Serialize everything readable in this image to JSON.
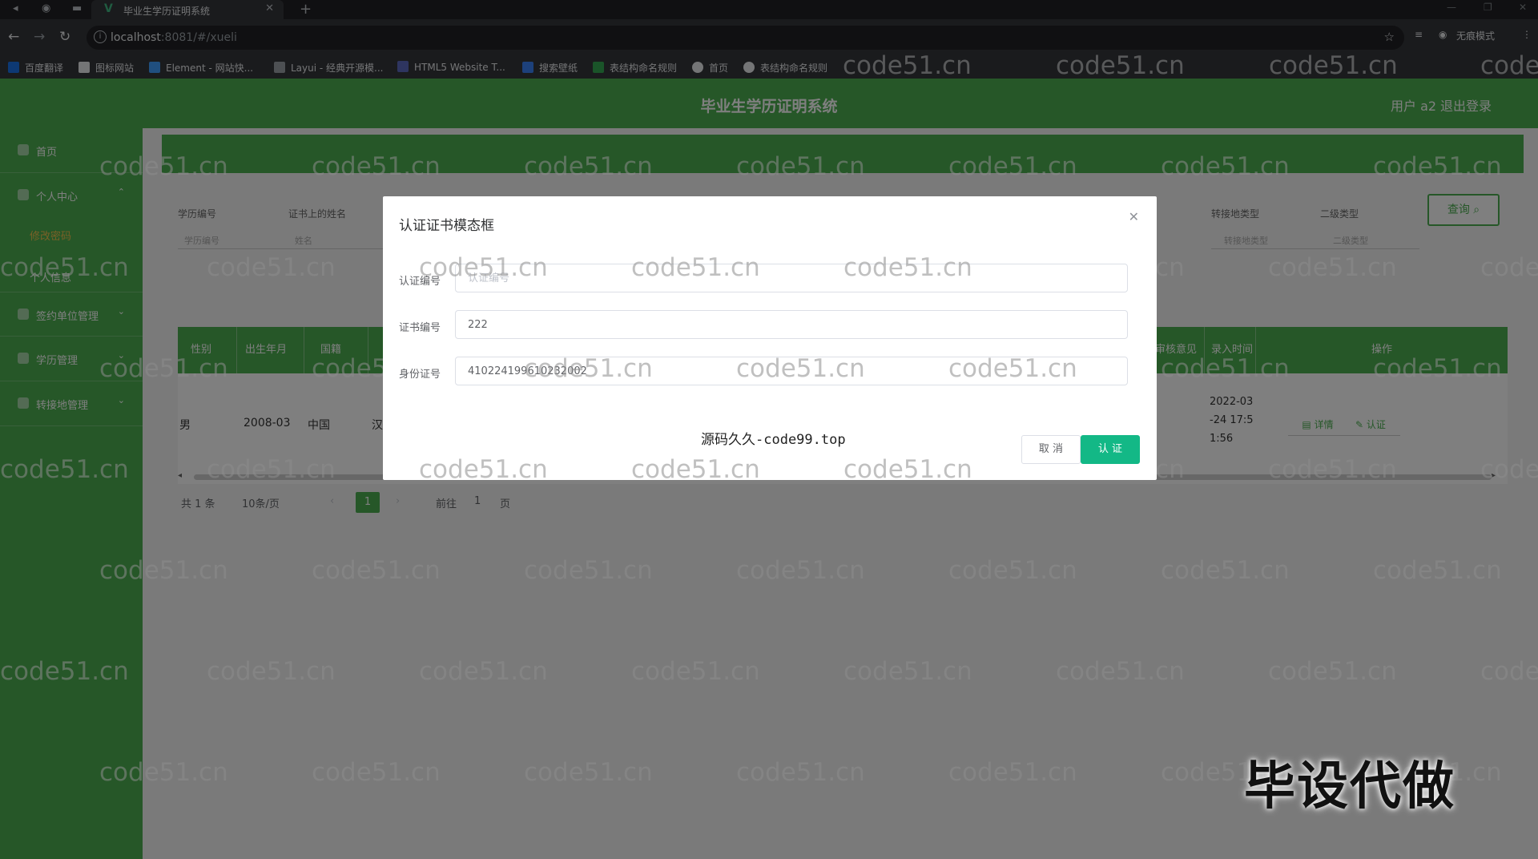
{
  "browser": {
    "tab_title": "毕业生学历证明系统",
    "url_host": "localhost",
    "url_rest": ":8081/#/xueli",
    "profile_label": "无痕模式",
    "bookmarks": [
      "百度翻译",
      "图标网站",
      "Element - 网站快...",
      "Layui - 经典开源模...",
      "HTML5 Website T...",
      "搜索壁纸",
      "表结构命名规则",
      "首页",
      "表结构命名规则"
    ]
  },
  "app": {
    "title": "毕业生学历证明系统",
    "user_label": "用户 a2",
    "logout_label": "退出登录"
  },
  "sidebar": {
    "items": [
      {
        "label": "首页"
      },
      {
        "label": "个人中心"
      },
      {
        "label": "签约单位管理"
      },
      {
        "label": "学历管理"
      },
      {
        "label": "转接地管理"
      }
    ],
    "sub_items": [
      {
        "label": "修改密码"
      },
      {
        "label": "个人信息"
      }
    ]
  },
  "search": {
    "fields": [
      "学历编号",
      "证书上的姓名",
      "转接地类型",
      "二级类型"
    ],
    "hints": [
      "学历编号",
      "姓名",
      "转接地类型",
      "二级类型"
    ],
    "query_label": "查询"
  },
  "table": {
    "columns": [
      "性别",
      "出生年月",
      "国籍",
      "审核意见",
      "录入时间",
      "操作"
    ],
    "row": {
      "gender": "男",
      "birth": "2008-03",
      "nationality": "中国",
      "ethnicity": "汉",
      "time_line1": "2022-03",
      "time_line2": "-24 17:5",
      "time_line3": "1:56",
      "detail_label": "详情",
      "verify_label": "认证"
    }
  },
  "pager": {
    "total": "共 1 条",
    "page_size": "10条/页",
    "current": "1",
    "goto_label": "前往",
    "goto_value": "1",
    "page_unit": "页"
  },
  "modal": {
    "title": "认证证书模态框",
    "fields": [
      {
        "label": "认证编号",
        "value": "",
        "placeholder": "认证编号"
      },
      {
        "label": "证书编号",
        "value": "222",
        "placeholder": ""
      },
      {
        "label": "身份证号",
        "value": "410224199610232002",
        "placeholder": ""
      }
    ],
    "cancel_label": "取 消",
    "confirm_label": "认 证"
  },
  "watermarks": {
    "repeat_text": "code51.cn",
    "center_text": "源码久久-code99.top",
    "corner_text": "毕设代做"
  },
  "colors": {
    "brand_green": "#4caf50",
    "confirm_teal": "#13b886"
  }
}
